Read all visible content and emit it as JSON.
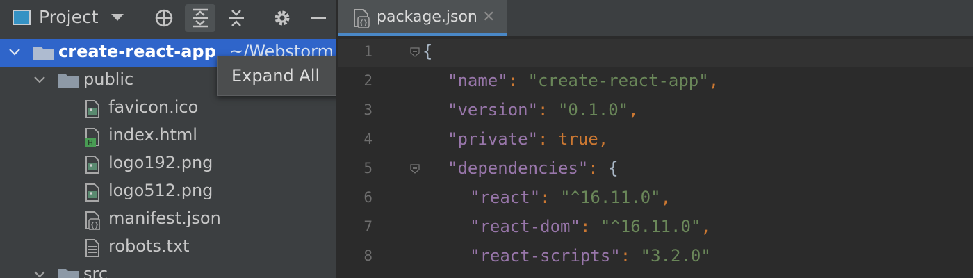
{
  "project_panel": {
    "title": "Project",
    "toolbar": {
      "locate_icon": "crosshair-icon",
      "expand_all_icon": "expand-all-icon",
      "collapse_all_icon": "collapse-all-icon",
      "settings_icon": "gear-icon",
      "hide_icon": "minus-icon"
    },
    "tree": {
      "root": {
        "label": "create-react-app",
        "path": "~/Webstorm"
      },
      "public": {
        "label": "public"
      },
      "files": [
        "favicon.ico",
        "index.html",
        "logo192.png",
        "logo512.png",
        "manifest.json",
        "robots.txt"
      ],
      "src": {
        "label": "src"
      }
    }
  },
  "tooltip": {
    "text": "Expand All",
    "shortcut": "⌘+"
  },
  "editor": {
    "tab": {
      "label": "package.json",
      "close": "✕"
    },
    "line_numbers": [
      "1",
      "2",
      "3",
      "4",
      "5",
      "6",
      "7",
      "8"
    ],
    "lines": [
      {
        "open_brace": "{"
      },
      {
        "key": "\"name\"",
        "colon": ": ",
        "value": "\"create-react-app\"",
        "comma": ","
      },
      {
        "key": "\"version\"",
        "colon": ": ",
        "value": "\"0.1.0\"",
        "comma": ","
      },
      {
        "key": "\"private\"",
        "colon": ": ",
        "value": "true",
        "comma": ","
      },
      {
        "key": "\"dependencies\"",
        "colon": ": ",
        "value": "{"
      },
      {
        "key": "\"react\"",
        "colon": ": ",
        "value": "\"^16.11.0\"",
        "comma": ","
      },
      {
        "key": "\"react-dom\"",
        "colon": ": ",
        "value": "\"^16.11.0\"",
        "comma": ","
      },
      {
        "key": "\"react-scripts\"",
        "colon": ": ",
        "value": "\"3.2.0\""
      }
    ]
  },
  "colors": {
    "selection": "#2f65ca",
    "json_key": "#9876aa",
    "json_string": "#6a8759",
    "json_keyword": "#cc7832",
    "tab_underline": "#4a88c7"
  }
}
